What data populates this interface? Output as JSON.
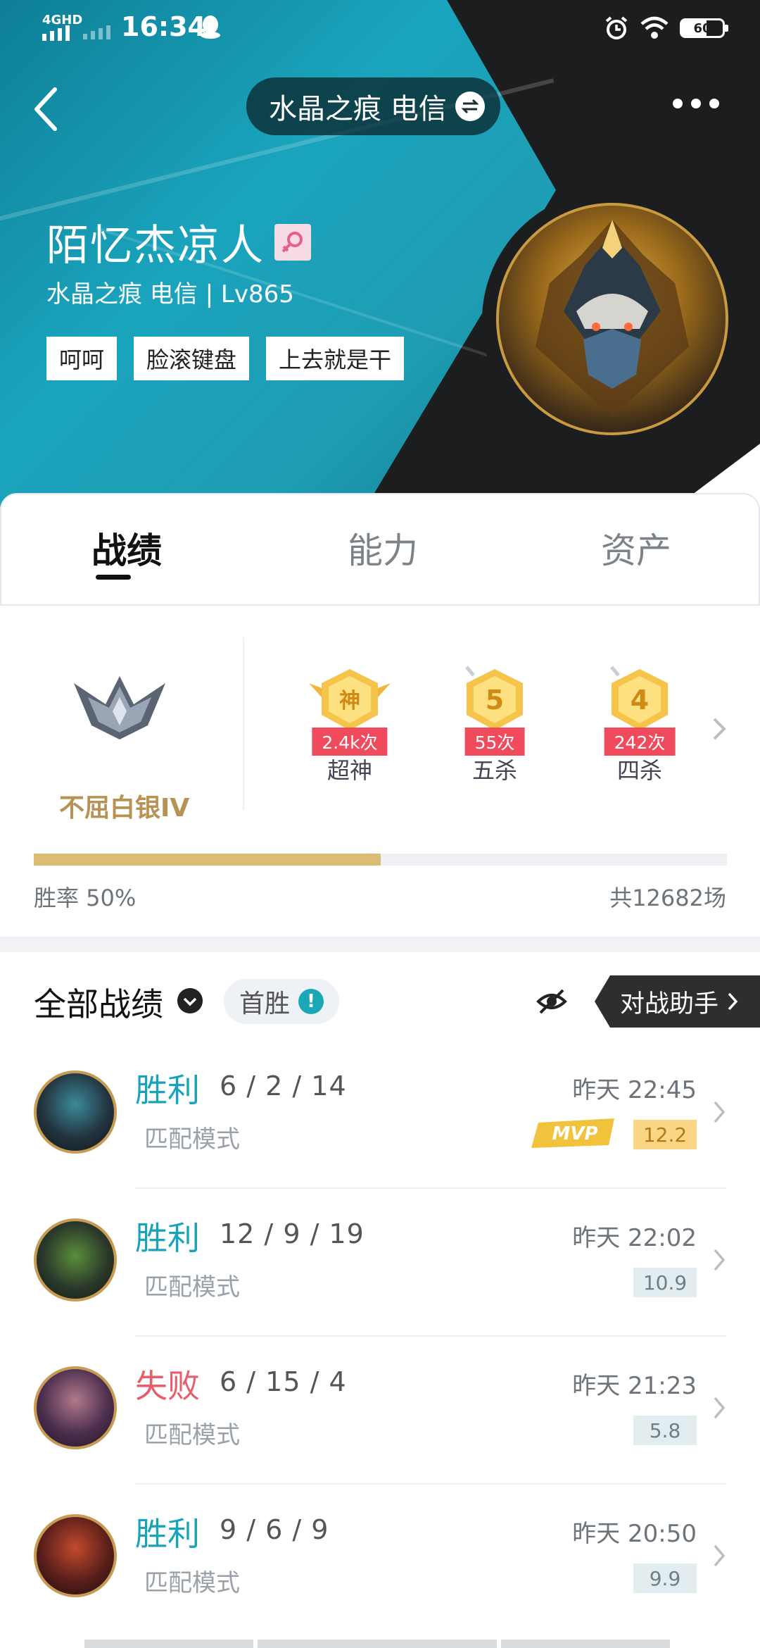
{
  "status_bar": {
    "network": "4GHD",
    "time": "16:34",
    "battery": "60"
  },
  "header": {
    "server": "水晶之痕 电信",
    "player_name": "陌忆杰凉人",
    "player_sub": "水晶之痕 电信 | Lv865",
    "tags": [
      "呵呵",
      "脸滚键盘",
      "上去就是干"
    ]
  },
  "tabs": [
    {
      "label": "战绩",
      "active": true
    },
    {
      "label": "能力",
      "active": false
    },
    {
      "label": "资产",
      "active": false
    }
  ],
  "stats": {
    "rank": "不屈白银IV",
    "honors": [
      {
        "icon_text": "神",
        "count": "2.4k次",
        "name": "超神"
      },
      {
        "icon_text": "5",
        "count": "55次",
        "name": "五杀"
      },
      {
        "icon_text": "4",
        "count": "242次",
        "name": "四杀"
      }
    ],
    "win_rate_label": "胜率  50%",
    "win_rate": 0.5,
    "total": "共12682场"
  },
  "matches_header": {
    "title": "全部战绩",
    "first_win": "首胜",
    "first_win_info": "!",
    "assistant": "对战助手"
  },
  "matches": [
    {
      "result": "胜利",
      "kda": "6 / 2 / 14",
      "mode": "匹配模式",
      "time": "昨天 22:45",
      "score": "12.2",
      "mvp": true,
      "mvp_label": "MVP"
    },
    {
      "result": "胜利",
      "kda": "12 / 9 / 19",
      "mode": "匹配模式",
      "time": "昨天 22:02",
      "score": "10.9",
      "mvp": false
    },
    {
      "result": "失败",
      "kda": "6 / 15 / 4",
      "mode": "匹配模式",
      "time": "昨天 21:23",
      "score": "5.8",
      "mvp": false
    },
    {
      "result": "胜利",
      "kda": "9 / 6 / 9",
      "mode": "匹配模式",
      "time": "昨天 20:50",
      "score": "9.9",
      "mvp": false
    }
  ],
  "colors": {
    "win": "#17a4bb",
    "lose": "#e85d6b",
    "accent_gold": "#dcbb74",
    "header_dark": "#1b1d1e",
    "header_teal": "#1aa4bd"
  }
}
